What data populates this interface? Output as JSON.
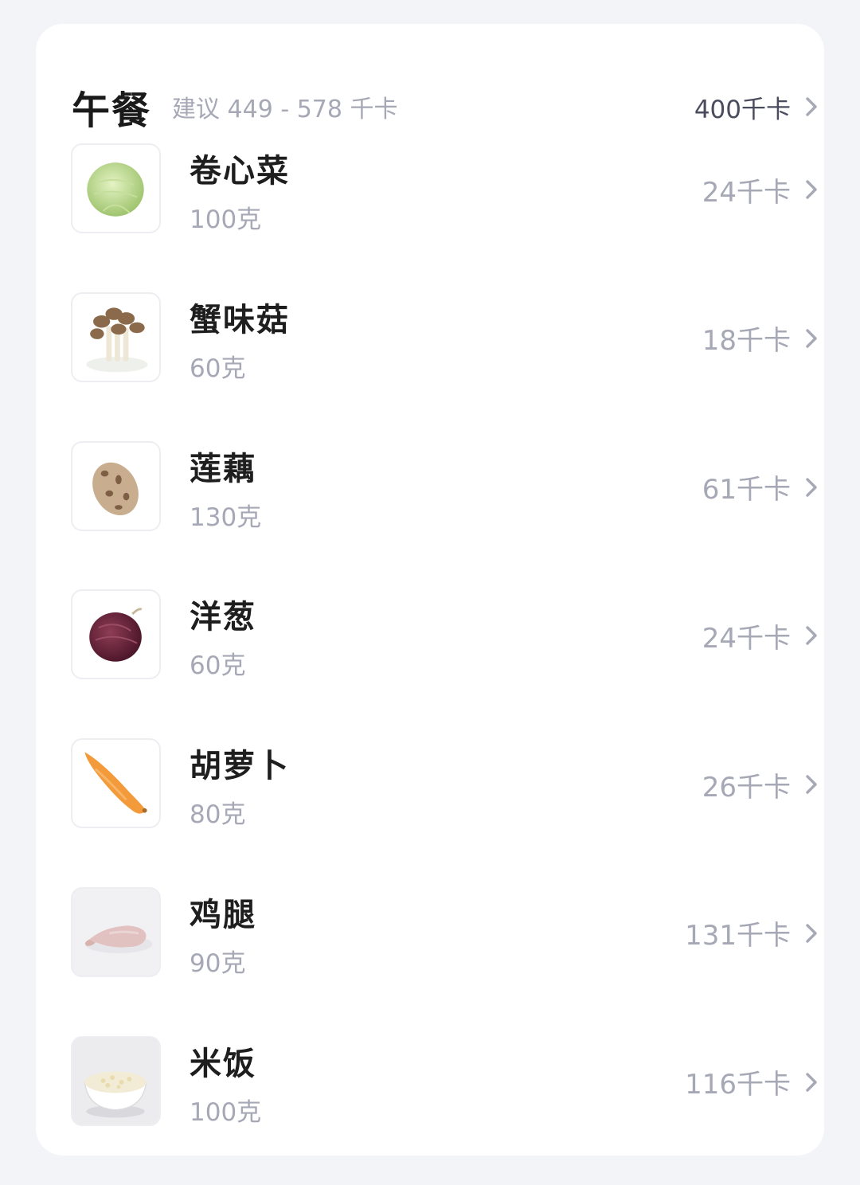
{
  "meal": {
    "title": "午餐",
    "suggestion": "建议 449 - 578 千卡",
    "total_kcal": "400千卡"
  },
  "foods": [
    {
      "name": "卷心菜",
      "amount": "100克",
      "kcal": "24千卡",
      "icon": "cabbage-icon"
    },
    {
      "name": "蟹味菇",
      "amount": "60克",
      "kcal": "18千卡",
      "icon": "mushroom-icon"
    },
    {
      "name": "莲藕",
      "amount": "130克",
      "kcal": "61千卡",
      "icon": "lotus-root-icon"
    },
    {
      "name": "洋葱",
      "amount": "60克",
      "kcal": "24千卡",
      "icon": "onion-icon"
    },
    {
      "name": "胡萝卜",
      "amount": "80克",
      "kcal": "26千卡",
      "icon": "carrot-icon"
    },
    {
      "name": "鸡腿",
      "amount": "90克",
      "kcal": "131千卡",
      "icon": "chicken-leg-icon"
    },
    {
      "name": "米饭",
      "amount": "100克",
      "kcal": "116千卡",
      "icon": "rice-bowl-icon"
    }
  ],
  "colors": {
    "background": "#f3f4f8",
    "card": "#ffffff",
    "title": "#1a1a1a",
    "muted": "#a6a8b6",
    "total": "#4a4c5e"
  }
}
